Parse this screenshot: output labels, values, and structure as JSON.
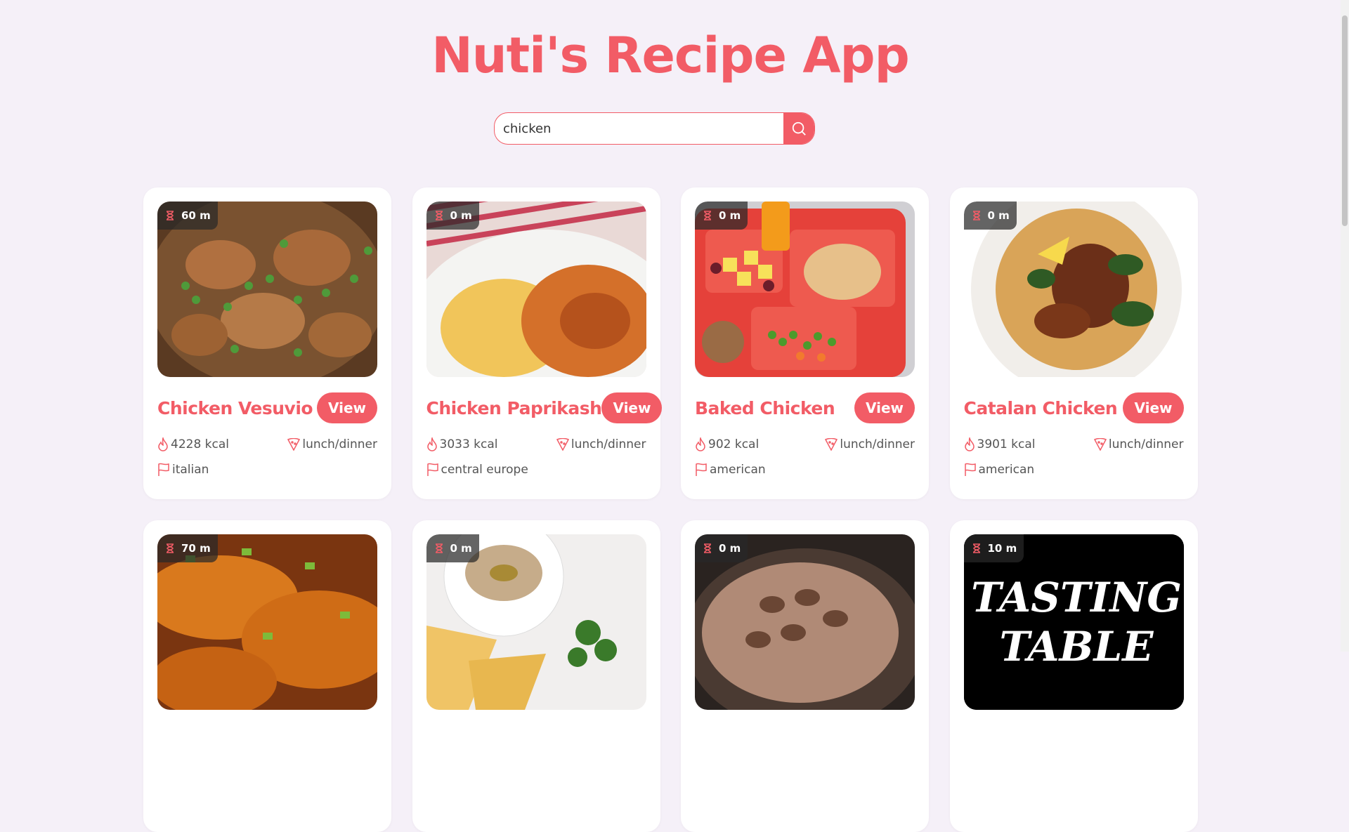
{
  "app": {
    "title": "Nuti's Recipe App"
  },
  "search": {
    "value": "chicken",
    "placeholder": ""
  },
  "accent": "#f25c66",
  "recipes": [
    {
      "time": "60 m",
      "name": "Chicken Vesuvio",
      "kcal": "4228 kcal",
      "meal": "lunch/dinner",
      "cuisine": "italian",
      "view": "View"
    },
    {
      "time": "0 m",
      "name": "Chicken Paprikash",
      "kcal": "3033 kcal",
      "meal": "lunch/dinner",
      "cuisine": "central europe",
      "view": "View"
    },
    {
      "time": "0 m",
      "name": "Baked Chicken",
      "kcal": "902 kcal",
      "meal": "lunch/dinner",
      "cuisine": "american",
      "view": "View"
    },
    {
      "time": "0 m",
      "name": "Catalan Chicken",
      "kcal": "3901 kcal",
      "meal": "lunch/dinner",
      "cuisine": "american",
      "view": "View"
    },
    {
      "time": "70 m",
      "name": "",
      "kcal": "",
      "meal": "",
      "cuisine": "",
      "view": ""
    },
    {
      "time": "0 m",
      "name": "",
      "kcal": "",
      "meal": "",
      "cuisine": "",
      "view": ""
    },
    {
      "time": "0 m",
      "name": "",
      "kcal": "",
      "meal": "",
      "cuisine": "",
      "view": ""
    },
    {
      "time": "10 m",
      "name": "",
      "kcal": "",
      "meal": "",
      "cuisine": "",
      "view": ""
    }
  ]
}
